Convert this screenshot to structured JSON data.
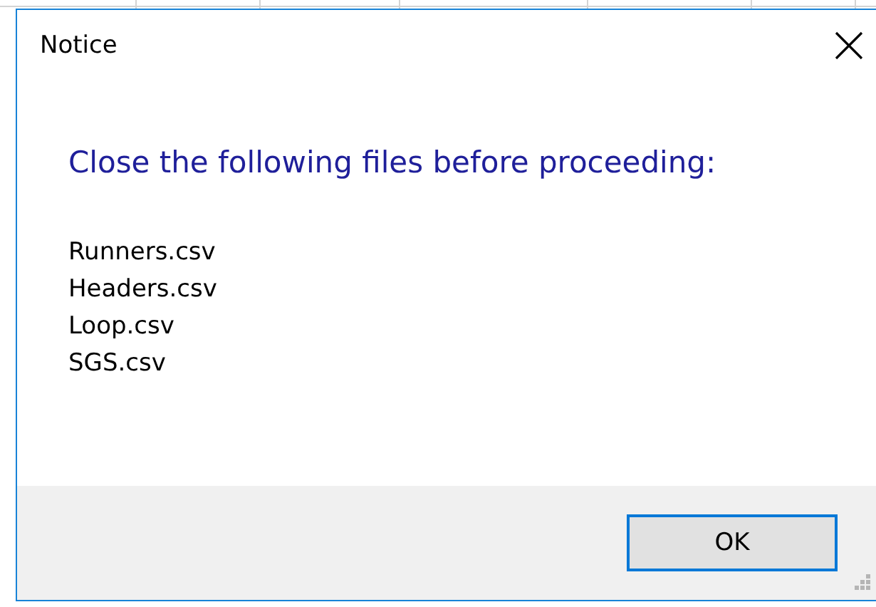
{
  "window": {
    "title": "Notice"
  },
  "message": {
    "heading": "Close the following files before proceeding:",
    "files": [
      "Runners.csv",
      "Headers.csv",
      "Loop.csv",
      "SGS.csv"
    ]
  },
  "buttons": [
    {
      "label": "OK",
      "focused": true
    }
  ]
}
